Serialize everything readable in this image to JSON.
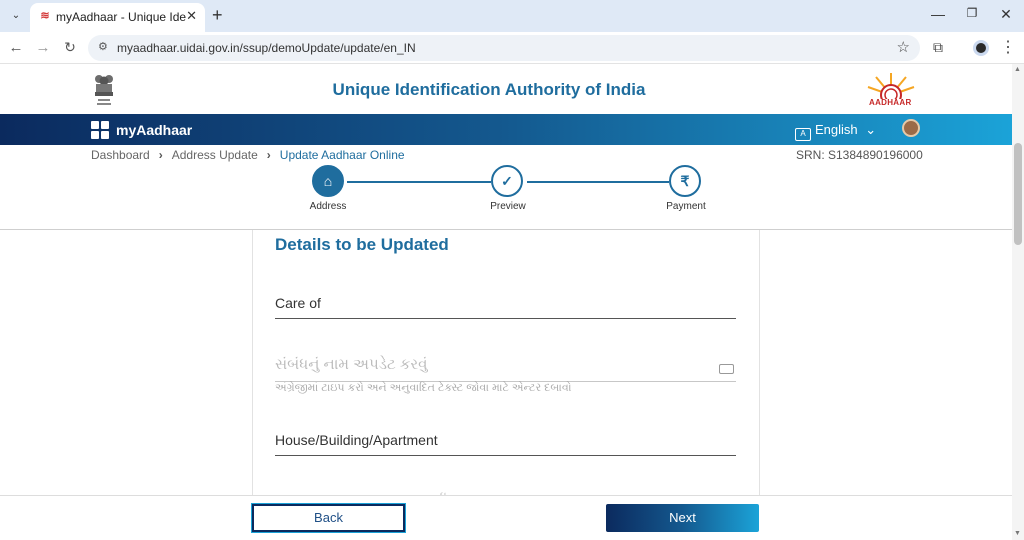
{
  "browser": {
    "tab_title": "myAadhaar - Unique Identificat",
    "url": "myaadhaar.uidai.gov.in/ssup/demoUpdate/update/en_IN"
  },
  "header": {
    "org_name": "Unique Identification Authority of India",
    "logo_text": "AADHAAR"
  },
  "navbar": {
    "brand": "myAadhaar",
    "language": "English"
  },
  "breadcrumb": [
    "Dashboard",
    "Address Update",
    "Update Aadhaar Online"
  ],
  "srn": "SRN: S1384890196000",
  "steps": [
    {
      "label": "Address",
      "status": "active"
    },
    {
      "label": "Preview",
      "status": "pending"
    },
    {
      "label": "Payment",
      "status": "pending"
    }
  ],
  "form": {
    "section_title": "Details to be Updated",
    "care_of_label": "Care of",
    "relation_placeholder": "સંબંધનું નામ અપડેટ કરવું",
    "transliteration_hint": "અંગ્રેજીમાં ટાઇપ કરો અને અનુવાદિત ટેક્સ્ટ જોવા માટે એન્ટર દબાવો",
    "house_label": "House/Building/Apartment",
    "partial_text": "ઘ"
  },
  "footer": {
    "back_label": "Back",
    "next_label": "Next"
  },
  "colors": {
    "primary": "#1f6d9e",
    "nav_start": "#0b2a5e",
    "nav_end": "#1ba3d8"
  }
}
